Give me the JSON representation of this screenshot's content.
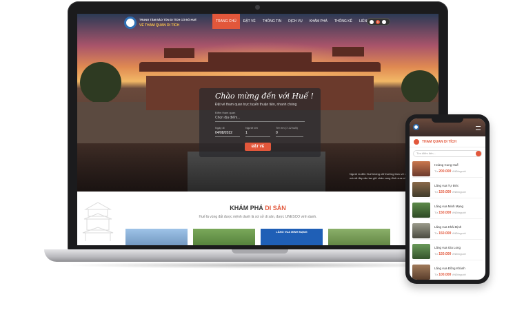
{
  "site": {
    "brand_top": "TRUNG TÂM BẢO TỒN DI TÍCH CỐ ĐÔ HUẾ",
    "brand_bottom": "VÉ THAM QUAN DI TÍCH",
    "nav": [
      "TRANG CHỦ",
      "ĐẶT VÉ",
      "THÔNG TIN",
      "DỊCH VỤ",
      "KHÁM PHÁ",
      "THỐNG KÊ",
      "LIÊN HỆ"
    ],
    "active_nav": "TRANG CHỦ",
    "cart_count": "0"
  },
  "booking": {
    "welcome": "Chào mừng đến với Huế !",
    "subtitle": "Đặt vé tham quan trực tuyến thuận tiện, nhanh chóng",
    "destination_label": "Điểm tham quan",
    "destination_placeholder": "Chọn địa điểm...",
    "date_label": "Ngày đi",
    "date_value": "04/08/2022",
    "adult_label": "Người lớn",
    "adult_value": "1",
    "child_label": "Trẻ em (7-12 tuổi)",
    "child_value": "0",
    "button": "ĐẶT VÉ"
  },
  "hero_caption": "Người ta đến Huế không chỉ thưởng thức vẻ đẹp... mưa, Huế vững mà rất đầy văn lao giữ chân cung đình xưa có của triều đại nhà...",
  "section": {
    "title_main": "KHÁM PHÁ",
    "title_accent": "DI SẢN",
    "subtitle": "Huế là vùng đất được mệnh danh là xứ sở di sản, được UNESCO vinh danh.",
    "card_label": "LĂNG VUA MINH MẠNG"
  },
  "phone": {
    "title": "THAM QUAN DI TÍCH",
    "search_placeholder": "Tìm điểm đến...",
    "items": [
      {
        "name": "Hoàng Cung Huế",
        "price": "200.000",
        "unit": "VNĐ/người"
      },
      {
        "name": "Lăng vua Tự Đức",
        "price": "150.000",
        "unit": "VNĐ/người"
      },
      {
        "name": "Lăng vua Minh Mạng",
        "price": "150.000",
        "unit": "VNĐ/người"
      },
      {
        "name": "Lăng vua Khải Định",
        "price": "150.000",
        "unit": "VNĐ/người"
      },
      {
        "name": "Lăng vua Gia Long",
        "price": "150.000",
        "unit": "VNĐ/người"
      },
      {
        "name": "Lăng vua Đồng Khánh",
        "price": "100.000",
        "unit": "VNĐ/người"
      }
    ],
    "price_prefix": "Từ"
  },
  "colors": {
    "accent": "#e2573b",
    "brand_blue": "#2f6fb3",
    "gold": "#f6c14a"
  }
}
